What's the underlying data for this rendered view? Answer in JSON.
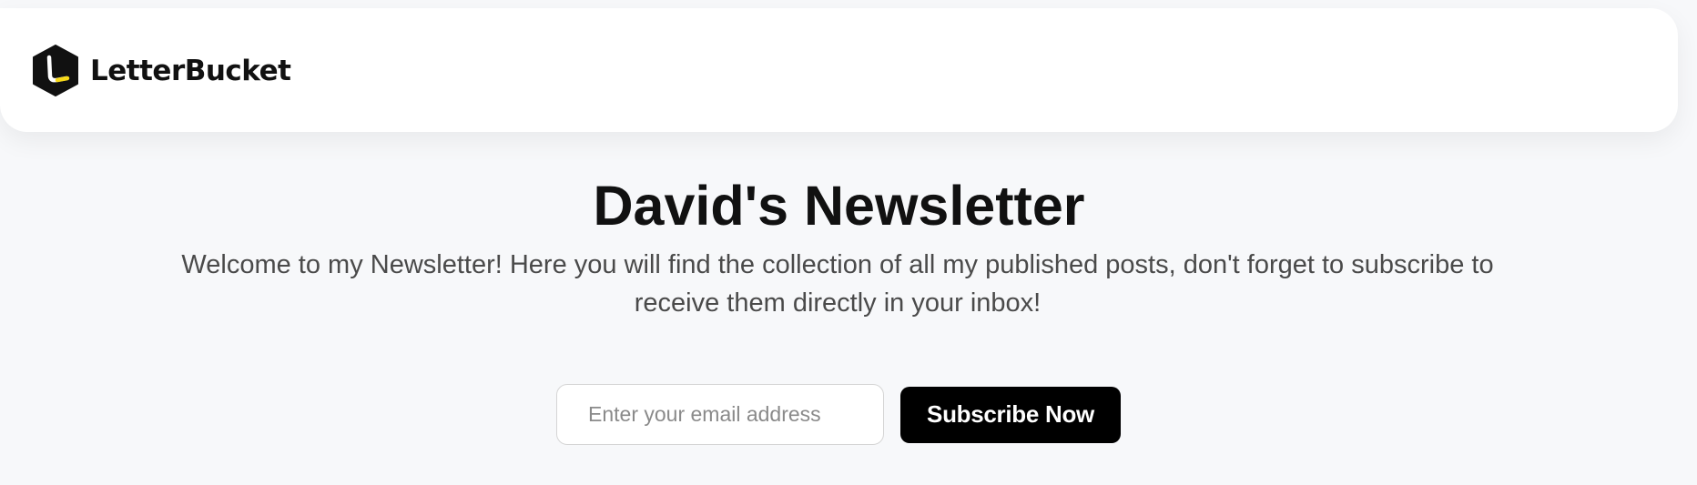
{
  "header": {
    "brand_name": "LetterBucket",
    "logo_icon": "letterbucket-logo-icon"
  },
  "newsletter": {
    "title": "David's Newsletter",
    "description": "Welcome to my Newsletter! Here you will find the collection of all my published posts, don't forget to subscribe to receive them directly in your inbox!"
  },
  "subscribe": {
    "email_placeholder": "Enter your email address",
    "email_value": "",
    "button_label": "Subscribe Now"
  },
  "colors": {
    "page_background": "#f7f8fa",
    "header_background": "#ffffff",
    "text_primary": "#111111",
    "text_secondary": "#4a4a4a",
    "button_background": "#000000",
    "button_text": "#ffffff",
    "logo_accent": "#f7d917"
  }
}
